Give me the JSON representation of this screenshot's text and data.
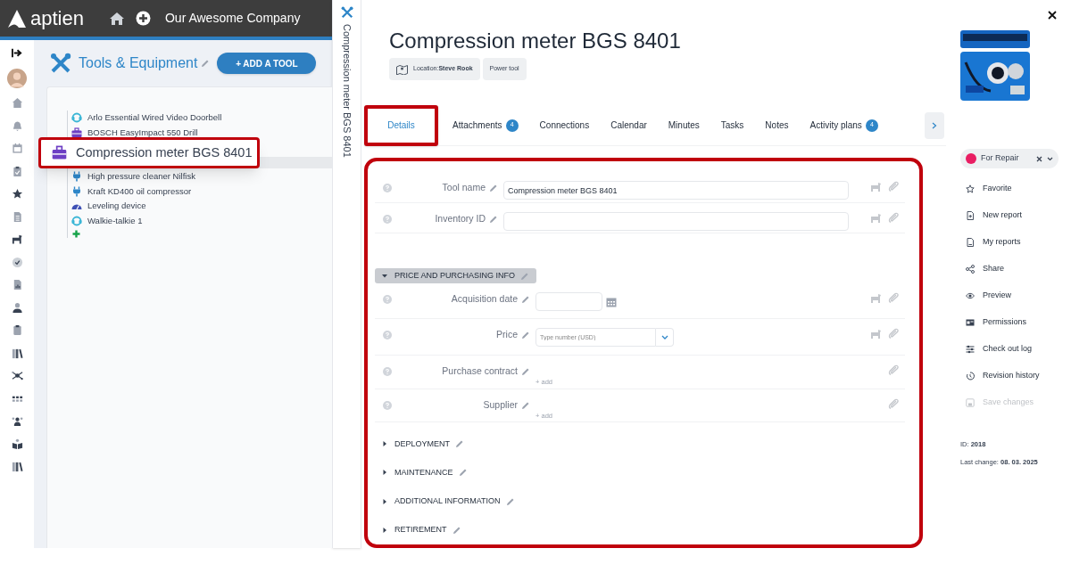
{
  "topbar": {
    "logo": "aptien",
    "company": "Our Awesome Company"
  },
  "module": {
    "title": "Tools & Equipment",
    "add_button": "+ ADD A TOOL"
  },
  "tree": [
    {
      "label": "Arlo Essential Wired Video Doorbell",
      "kind": "headset",
      "selected": false
    },
    {
      "label": "BOSCH EasyImpact 550 Drill",
      "kind": "toolbox",
      "selected": false
    },
    {
      "label": "Compression meter BGS 8401",
      "kind": "toolbox",
      "selected": true
    },
    {
      "label": "High pressure cleaner Nilfisk",
      "kind": "plug",
      "selected": false
    },
    {
      "label": "Kraft KD400 oil compressor",
      "kind": "plug",
      "selected": false
    },
    {
      "label": "Leveling device",
      "kind": "gauge",
      "selected": false
    },
    {
      "label": "Walkie-talkie 1",
      "kind": "headset",
      "selected": false
    }
  ],
  "vertical_title": "Compression meter BGS 8401",
  "record": {
    "title": "Compression meter BGS 8401",
    "tags": [
      {
        "text": "Location:**Steve Rook**",
        "kind": "location"
      },
      {
        "text": "Power tool",
        "kind": "plain"
      }
    ]
  },
  "tabs": [
    {
      "label": "Details",
      "selected": true
    },
    {
      "label": "Attachments",
      "badge": "4",
      "selected": false
    },
    {
      "label": "Connections",
      "selected": false
    },
    {
      "label": "Calendar",
      "selected": false
    },
    {
      "label": "Minutes",
      "selected": false
    },
    {
      "label": "Tasks",
      "selected": false
    },
    {
      "label": "Notes",
      "selected": false
    },
    {
      "label": "Activity plans",
      "badge": "4",
      "selected": false
    }
  ],
  "fields": [
    {
      "label": "Tool name",
      "kind": "text",
      "value": "Compression meter BGS 8401"
    },
    {
      "label": "Inventory ID",
      "kind": "text"
    }
  ],
  "groups": [
    {
      "title": "PRICE AND PURCHASING INFO",
      "expanded": true,
      "fields": [
        {
          "label": "Acquisition date",
          "kind": "date"
        },
        {
          "label": "Price",
          "kind": "number",
          "placeholder": "Type number (USD)"
        },
        {
          "label": "Purchase contract",
          "kind": "link",
          "add": "+ add"
        },
        {
          "label": "Supplier",
          "kind": "link",
          "add": "+ add"
        }
      ]
    },
    {
      "title": "DEPLOYMENT",
      "expanded": false
    },
    {
      "title": "MAINTENANCE",
      "expanded": false
    },
    {
      "title": "ADDITIONAL INFORMATION",
      "expanded": false
    },
    {
      "title": "RETIREMENT",
      "expanded": false
    }
  ],
  "status": {
    "label": "For Repair",
    "color": "#e91e63"
  },
  "actions": [
    {
      "label": "Favorite",
      "kind": "star",
      "disabled": false
    },
    {
      "label": "New report",
      "kind": "doc-plus",
      "disabled": false
    },
    {
      "label": "My reports",
      "kind": "doc",
      "disabled": false
    },
    {
      "label": "Share",
      "kind": "share",
      "disabled": false
    },
    {
      "label": "Preview",
      "kind": "eye",
      "disabled": false
    },
    {
      "label": "Permissions",
      "kind": "card",
      "disabled": false
    },
    {
      "label": "Check out log",
      "kind": "log",
      "disabled": false
    },
    {
      "label": "Revision history",
      "kind": "history",
      "disabled": false
    },
    {
      "label": "Save changes",
      "kind": "save",
      "disabled": true
    }
  ],
  "meta": [
    {
      "label": "ID:",
      "value": "2018"
    },
    {
      "label": "Last change:",
      "value": "08. 03. 2025"
    }
  ]
}
